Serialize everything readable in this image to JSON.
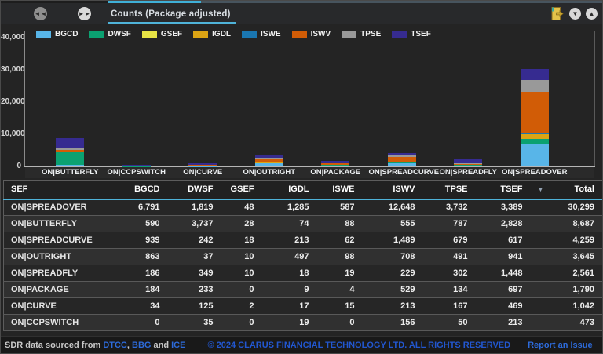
{
  "header": {
    "tab_title": "Counts (Package adjusted)",
    "skip_back_glyph": "◄◄",
    "skip_forward_glyph": "►►",
    "collapse_glyph": "▼",
    "expand_glyph": "▲",
    "accent_color": "#4fb3d9"
  },
  "chart_data": {
    "type": "bar",
    "stacked": true,
    "title": "Counts (Package adjusted)",
    "grid": false,
    "legend_position": "top",
    "ylim": [
      0,
      40000
    ],
    "yticks": [
      "40,000",
      "30,000",
      "20,000",
      "10,000",
      "0"
    ],
    "categories": [
      "ON|BUTTERFLY",
      "ON|CCPSWITCH",
      "ON|CURVE",
      "ON|OUTRIGHT",
      "ON|PACKAGE",
      "ON|SPREADCURVE",
      "ON|SPREADFLY",
      "ON|SPREADOVER"
    ],
    "series": [
      {
        "name": "BGCD",
        "color": "#58b5e8",
        "values": [
          590,
          0,
          34,
          863,
          184,
          939,
          186,
          6791
        ]
      },
      {
        "name": "DWSF",
        "color": "#0ba171",
        "values": [
          3737,
          35,
          125,
          37,
          233,
          242,
          349,
          1819
        ]
      },
      {
        "name": "GSEF",
        "color": "#e7e345",
        "values": [
          28,
          0,
          2,
          10,
          0,
          18,
          10,
          48
        ]
      },
      {
        "name": "IGDL",
        "color": "#dca414",
        "values": [
          74,
          19,
          17,
          497,
          9,
          213,
          18,
          1285
        ]
      },
      {
        "name": "ISWE",
        "color": "#1a76b0",
        "values": [
          88,
          0,
          15,
          98,
          4,
          62,
          19,
          587
        ]
      },
      {
        "name": "ISWV",
        "color": "#d15c06",
        "values": [
          555,
          156,
          213,
          708,
          529,
          1489,
          229,
          12648
        ]
      },
      {
        "name": "TPSE",
        "color": "#999999",
        "values": [
          787,
          50,
          167,
          491,
          134,
          679,
          302,
          3732
        ]
      },
      {
        "name": "TSEF",
        "color": "#362b90",
        "values": [
          2828,
          213,
          469,
          941,
          697,
          617,
          1448,
          3389
        ]
      }
    ]
  },
  "table": {
    "columns": [
      "SEF",
      "BGCD",
      "DWSF",
      "GSEF",
      "IGDL",
      "ISWE",
      "ISWV",
      "TPSE",
      "TSEF",
      "Total"
    ],
    "sort": {
      "column": "Total",
      "direction": "desc",
      "icon": "▼"
    },
    "rows": [
      {
        "sef": "ON|SPREADOVER",
        "values": [
          "6,791",
          "1,819",
          "48",
          "1,285",
          "587",
          "12,648",
          "3,732",
          "3,389",
          "30,299"
        ]
      },
      {
        "sef": "ON|BUTTERFLY",
        "values": [
          "590",
          "3,737",
          "28",
          "74",
          "88",
          "555",
          "787",
          "2,828",
          "8,687"
        ]
      },
      {
        "sef": "ON|SPREADCURVE",
        "values": [
          "939",
          "242",
          "18",
          "213",
          "62",
          "1,489",
          "679",
          "617",
          "4,259"
        ]
      },
      {
        "sef": "ON|OUTRIGHT",
        "values": [
          "863",
          "37",
          "10",
          "497",
          "98",
          "708",
          "491",
          "941",
          "3,645"
        ]
      },
      {
        "sef": "ON|SPREADFLY",
        "values": [
          "186",
          "349",
          "10",
          "18",
          "19",
          "229",
          "302",
          "1,448",
          "2,561"
        ]
      },
      {
        "sef": "ON|PACKAGE",
        "values": [
          "184",
          "233",
          "0",
          "9",
          "4",
          "529",
          "134",
          "697",
          "1,790"
        ]
      },
      {
        "sef": "ON|CURVE",
        "values": [
          "34",
          "125",
          "2",
          "17",
          "15",
          "213",
          "167",
          "469",
          "1,042"
        ]
      },
      {
        "sef": "ON|CCPSWITCH",
        "values": [
          "0",
          "35",
          "0",
          "19",
          "0",
          "156",
          "50",
          "213",
          "473"
        ]
      }
    ]
  },
  "footer": {
    "prefix": "SDR data sourced from",
    "sources": [
      "DTCC",
      "BBG",
      "ICE"
    ],
    "sep_comma": ", ",
    "sep_and": " and ",
    "copyright": "© 2024 CLARUS FINANCIAL TECHNOLOGY LTD. ALL RIGHTS RESERVED",
    "report_link": "Report an Issue"
  }
}
